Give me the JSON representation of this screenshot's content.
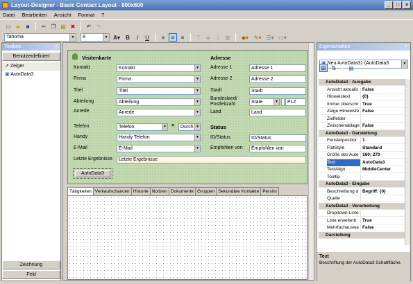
{
  "window": {
    "title": "Layout-Designer - Basic Contact Layout - 800x600",
    "btn_min": "_",
    "btn_max": "□",
    "btn_close": "×"
  },
  "menu": [
    "Datei",
    "Bearbeiten",
    "Ansicht",
    "Format",
    "?"
  ],
  "format_toolbar": {
    "font": "Tahoma",
    "size": "8"
  },
  "toolbox": {
    "title": "Toolbox",
    "category": "Benutzerdefiniert",
    "items": [
      "Zeiger",
      "AutoData3"
    ],
    "bottom_tabs": [
      "Zeichnung",
      "Feld"
    ]
  },
  "form": {
    "left_header": "Visitenkarte",
    "right_header": "Adresse",
    "status_header": "Status",
    "left_rows": [
      {
        "label": "Kontakt",
        "value": "Kontakt"
      },
      {
        "label": "Firma",
        "value": "Firma"
      },
      {
        "label": "Titel",
        "value": "Titel"
      },
      {
        "label": "Abteilung",
        "value": "Abteilung"
      },
      {
        "label": "Anrede",
        "value": "Anrede"
      },
      {
        "label": "Telefon",
        "value": "Telefon"
      },
      {
        "label": "Handy",
        "value": "Handy Telefon"
      },
      {
        "label": "E-Mail",
        "value": "E-Mail"
      }
    ],
    "phone_extra": "Durch",
    "phone_x": "×",
    "right_rows": [
      {
        "label": "Adresse 1",
        "value": "Adresse 1"
      },
      {
        "label": "Adresse 2",
        "value": "Adresse 2"
      },
      {
        "label": "Stadt",
        "value": "Stadt"
      },
      {
        "label": "Bundesland/ Postleitzahl",
        "value": "State"
      },
      {
        "label": "Land",
        "value": "Land"
      }
    ],
    "plz": "PLZ",
    "status_rows": [
      {
        "label": "ID/Status",
        "value": "ID/Status"
      },
      {
        "label": "Empfohlen von",
        "value": "Empfohlen von"
      }
    ],
    "last_results_label": "Letzte Ergebnisse",
    "last_results_value": "Letzte Ergebnisse",
    "autodata_button": "AutoData3"
  },
  "tabs": [
    "Tätigkeiten",
    "Verkaufschancen",
    "Historie",
    "Notizen",
    "Dokumente",
    "Gruppen",
    "Sekundäre Kontakte",
    "Persön"
  ],
  "properties": {
    "title": "Eigenschaften",
    "object": "Neu AutoData31 (AutoData3",
    "rows": [
      {
        "cat": "AutoData3 - Ausgabe"
      },
      {
        "name": "Ansicht aktualis",
        "value": "False"
      },
      {
        "name": "Hinweistext",
        "value": "{0}"
      },
      {
        "name": "Immer überschr",
        "value": "True"
      },
      {
        "name": "Zeige Hinweisfe",
        "value": "False"
      },
      {
        "name": "Zielfelder",
        "value": ""
      },
      {
        "name": "Zwischenablage",
        "value": "False"
      },
      {
        "cat": "AutoData3 - Darstellung"
      },
      {
        "name": "Fensterpositior",
        "value": "1"
      },
      {
        "name": "FlatStyle",
        "value": "Standard"
      },
      {
        "name": "Größe des Auto",
        "value": "160; 270"
      },
      {
        "name": "Text",
        "value": "AutoData3",
        "selected": true
      },
      {
        "name": "TextAlign",
        "value": "MiddleCenter"
      },
      {
        "name": "Tooltip",
        "value": ""
      },
      {
        "cat": "AutoData3 - Eingabe"
      },
      {
        "name": "Beschreibung d",
        "value": "Begriff: {0}"
      },
      {
        "name": "Quelle",
        "value": ""
      },
      {
        "cat": "AutoData3 - Verarbeitung"
      },
      {
        "name": "Dropdown-Liste",
        "value": ""
      },
      {
        "name": "Liste erweiterb",
        "value": "True"
      },
      {
        "name": "Mehrfachauswa",
        "value": "False"
      },
      {
        "cat": "Darstellung"
      }
    ],
    "help_title": "Text",
    "help_text": "Beschriftung der AutoData3 Schaltfläche."
  }
}
